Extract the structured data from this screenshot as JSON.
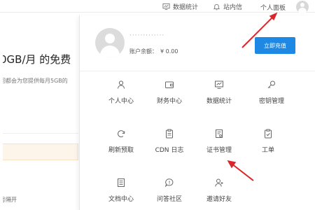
{
  "topbar": {
    "stats_label": "数据统计",
    "messages_label": "站内信",
    "panel_label": "个人面板"
  },
  "background": {
    "heading": "0GB/月 的免费",
    "subtext": "回都会为您提供每月5GB的",
    "footer": "号隔开"
  },
  "account": {
    "username": "·············",
    "balance_label": "账户余额：",
    "balance_value": "¥ 0.00",
    "recharge_button": "立即充值"
  },
  "menu": {
    "items": [
      {
        "label": "个人中心",
        "icon": "user-icon"
      },
      {
        "label": "财务中心",
        "icon": "wallet-icon"
      },
      {
        "label": "数据统计",
        "icon": "chart-monitor-icon"
      },
      {
        "label": "密钥管理",
        "icon": "key-icon"
      },
      {
        "label": "刷新预取",
        "icon": "refresh-icon"
      },
      {
        "label": "CDN 日志",
        "icon": "clipboard-icon"
      },
      {
        "label": "证书管理",
        "icon": "certificate-icon"
      },
      {
        "label": "工单",
        "icon": "ticket-check-icon"
      },
      {
        "label": "文档中心",
        "icon": "document-icon"
      },
      {
        "label": "问答社区",
        "icon": "chat-icon"
      },
      {
        "label": "邀请好友",
        "icon": "invite-user-icon"
      }
    ]
  },
  "colors": {
    "accent": "#1e88e5",
    "annotation_arrow": "#d9262b",
    "notice_bg": "#fdf4ea"
  }
}
